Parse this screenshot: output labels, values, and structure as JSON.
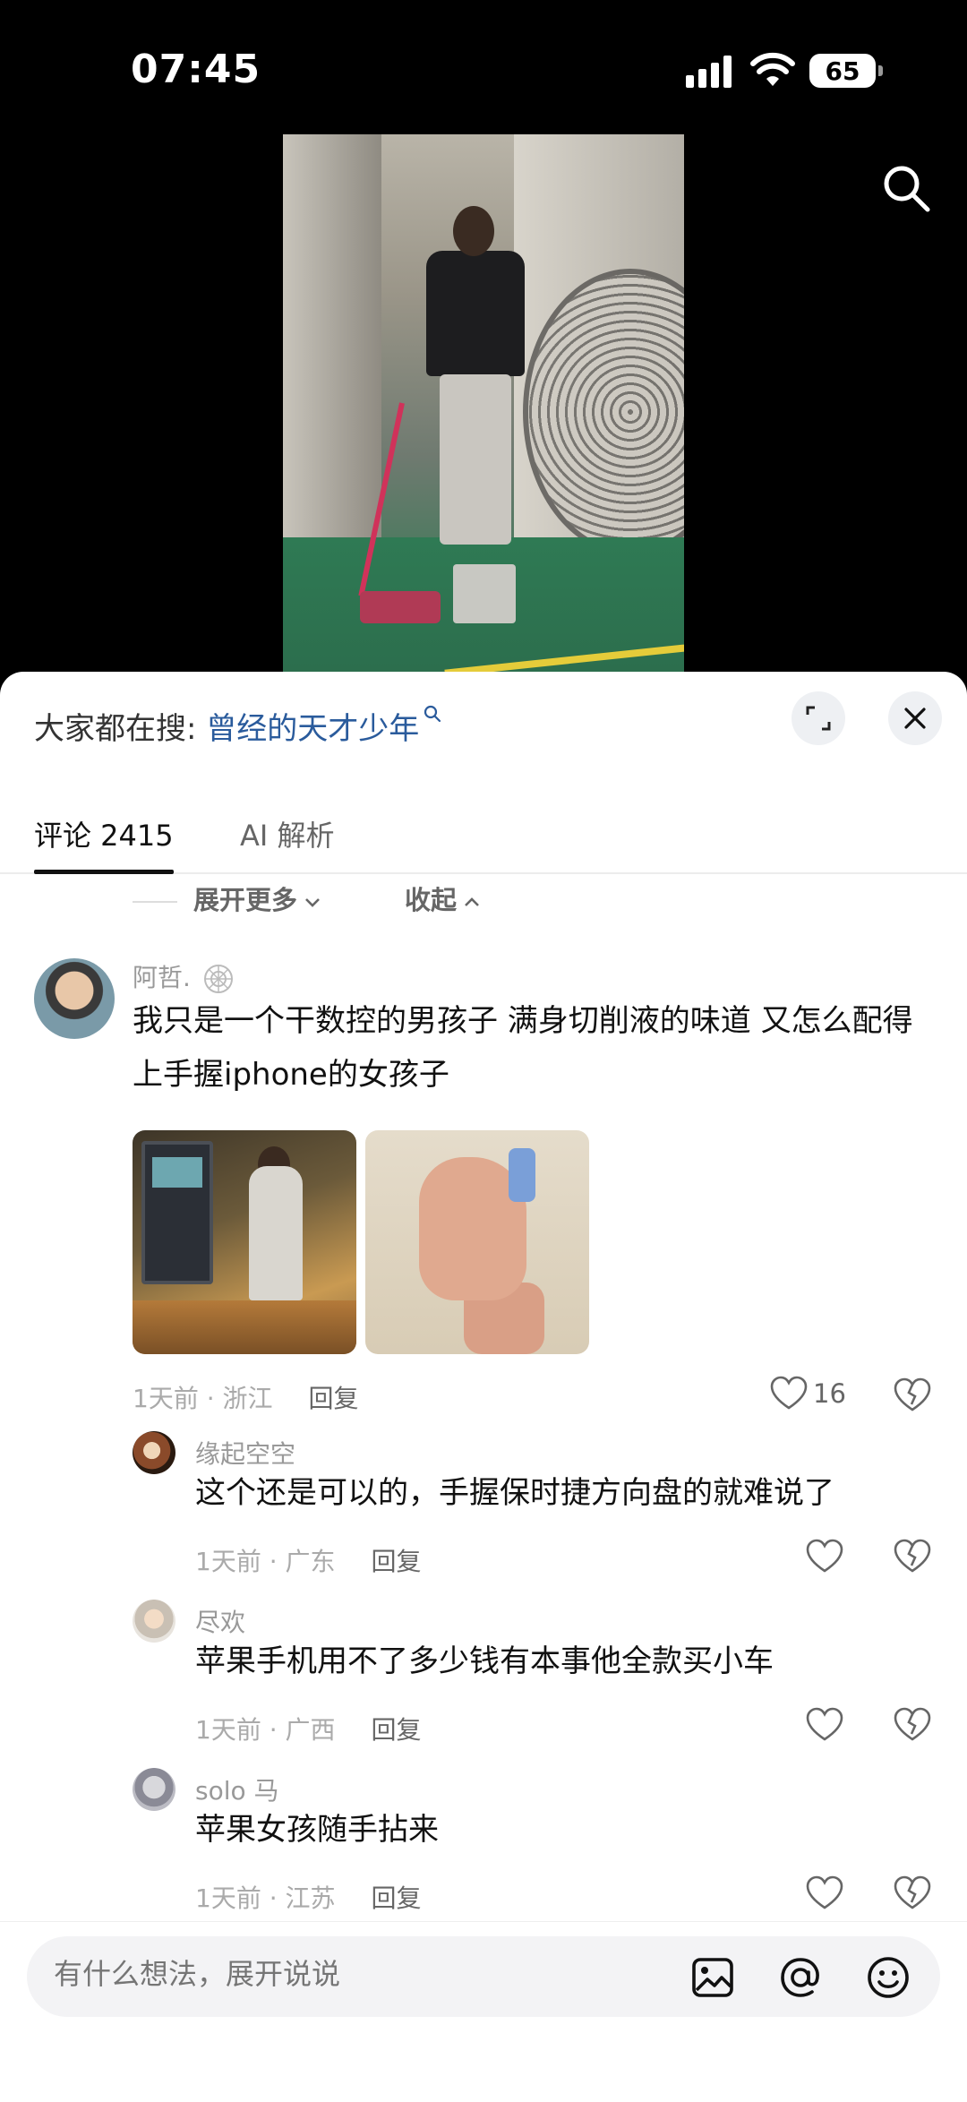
{
  "status_bar": {
    "time": "07:45",
    "battery": "65"
  },
  "hot_search": {
    "prefix": "大家都在搜: ",
    "term": "曾经的天才少年"
  },
  "tabs": {
    "comments": "评论 2415",
    "ai": "AI 解析"
  },
  "replies_controls": {
    "expand_more": "展开更多",
    "collapse": "收起"
  },
  "comments": [
    {
      "user": "阿哲.",
      "text": "我只是一个干数控的男孩子 满身切削液的味道 又怎么配得上手握iphone的女孩子",
      "time_location": "1天前 · 浙江",
      "reply": "回复",
      "likes": "16"
    },
    {
      "user": "缘起空空",
      "text": "这个还是可以的，手握保时捷方向盘的就难说了",
      "time_location": "1天前 · 广东",
      "reply": "回复"
    },
    {
      "user": "尽欢",
      "text": "苹果手机用不了多少钱有本事他全款买小车",
      "time_location": "1天前 · 广西",
      "reply": "回复"
    },
    {
      "user": "solo 马",
      "text": "苹果女孩随手拈来",
      "time_location": "1天前 · 江苏",
      "reply": "回复"
    }
  ],
  "input": {
    "placeholder": "有什么想法，展开说说"
  },
  "icons": [
    "search-icon",
    "expand-icon",
    "close-icon",
    "heart-icon",
    "broken-heart-icon",
    "image-icon",
    "at-icon",
    "emoji-icon"
  ],
  "colors": {
    "accent_link": "#2a5b9c",
    "text": "#111111",
    "muted": "#999999"
  }
}
